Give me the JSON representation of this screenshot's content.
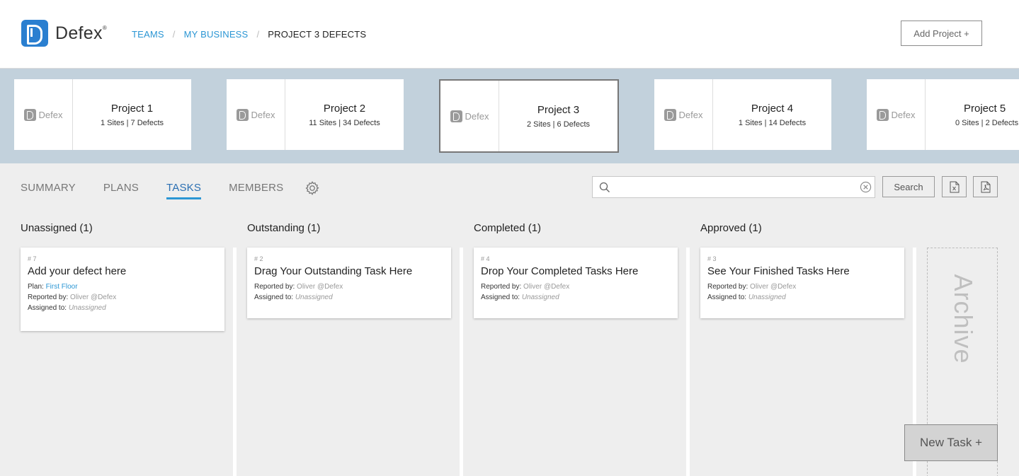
{
  "header": {
    "logo_text": "Defex",
    "breadcrumb": {
      "teams": "TEAMS",
      "business": "MY BUSINESS",
      "current": "PROJECT 3 DEFECTS",
      "separator": "/"
    },
    "add_project_label": "Add Project +"
  },
  "projects": [
    {
      "logo_text": "Defex",
      "name": "Project 1",
      "meta": "1 Sites | 7 Defects"
    },
    {
      "logo_text": "Defex",
      "name": "Project 2",
      "meta": "11 Sites | 34 Defects"
    },
    {
      "logo_text": "Defex",
      "name": "Project 3",
      "meta": "2 Sites | 6 Defects",
      "selected": true
    },
    {
      "logo_text": "Defex",
      "name": "Project 4",
      "meta": "1 Sites | 14 Defects"
    },
    {
      "logo_text": "Defex",
      "name": "Project 5",
      "meta": "0 Sites | 2 Defects"
    }
  ],
  "tabs": [
    {
      "label": "SUMMARY"
    },
    {
      "label": "PLANS"
    },
    {
      "label": "TASKS",
      "active": true
    },
    {
      "label": "MEMBERS"
    }
  ],
  "settings_icon": "gear-icon",
  "search": {
    "value": "",
    "placeholder": "",
    "button_label": "Search",
    "export_excel_icon": "excel-file-icon",
    "export_pdf_icon": "pdf-file-icon"
  },
  "columns": [
    {
      "title": "Unassigned (1)",
      "tasks": [
        {
          "num": "# 7",
          "title": "Add your defect here",
          "plan_label": "Plan:",
          "plan": "First Floor",
          "reported_label": "Reported by:",
          "reported_by": "Oliver @Defex",
          "assigned_label": "Assigned to:",
          "assigned_to": "Unassigned"
        }
      ]
    },
    {
      "title": "Outstanding (1)",
      "tasks": [
        {
          "num": "# 2",
          "title": "Drag Your Outstanding Task Here",
          "reported_label": "Reported by:",
          "reported_by": "Oliver @Defex",
          "assigned_label": "Assigned to:",
          "assigned_to": "Unassigned"
        }
      ]
    },
    {
      "title": "Completed (1)",
      "tasks": [
        {
          "num": "# 4",
          "title": "Drop Your Completed Tasks Here",
          "reported_label": "Reported by:",
          "reported_by": "Oliver @Defex",
          "assigned_label": "Assigned to:",
          "assigned_to": "Unassigned"
        }
      ]
    },
    {
      "title": "Approved (1)",
      "tasks": [
        {
          "num": "# 3",
          "title": "See Your Finished Tasks Here",
          "reported_label": "Reported by:",
          "reported_by": "Oliver @Defex",
          "assigned_label": "Assigned to:",
          "assigned_to": "Unassigned"
        }
      ]
    }
  ],
  "archive_label": "Archive",
  "new_task_label": "New Task +",
  "colors": {
    "accent": "#2b96d4",
    "brand": "#2a7fd0",
    "strip_bg": "#c2d1dc",
    "page_bg": "#eeeeee"
  }
}
